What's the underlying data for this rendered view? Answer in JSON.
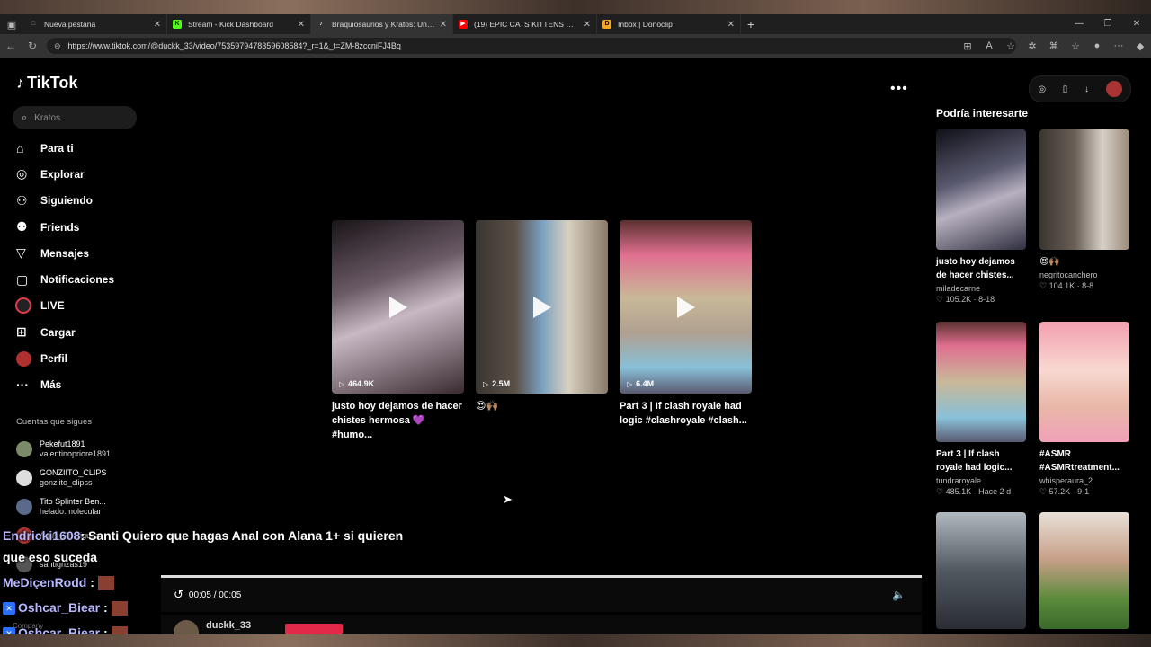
{
  "browser": {
    "tabs": [
      {
        "title": "Nueva pestaña",
        "favicon_color": "#9aa0a6",
        "favicon_glyph": "□"
      },
      {
        "title": "Stream - Kick Dashboard",
        "favicon_color": "#53fc18",
        "favicon_glyph": "K"
      },
      {
        "title": "Braquiosaurios y Kratos: Un Choq",
        "favicon_color": "#ffffff",
        "favicon_glyph": "♪",
        "active": true
      },
      {
        "title": "(19) EPIC CATS KITTENS WORLD (",
        "favicon_color": "#ff0000",
        "favicon_glyph": "▶"
      },
      {
        "title": "Inbox | Donoclip",
        "favicon_color": "#f5a623",
        "favicon_glyph": "D"
      }
    ],
    "new_tab_glyph": "+",
    "url": "https://www.tiktok.com/@duckk_33/video/7535979478359608584?_r=1&_t=ZM-8zccniFJ4Bq"
  },
  "tiktok": {
    "logo": "TikTok",
    "search_placeholder": "Kratos",
    "nav": [
      {
        "label": "Para ti",
        "icon": "home-icon",
        "glyph": "⌂"
      },
      {
        "label": "Explorar",
        "icon": "compass-icon",
        "glyph": "◎"
      },
      {
        "label": "Siguiendo",
        "icon": "following-icon",
        "glyph": "👤"
      },
      {
        "label": "Friends",
        "icon": "friends-icon",
        "glyph": "👥"
      },
      {
        "label": "Mensajes",
        "icon": "messages-icon",
        "glyph": "▽"
      },
      {
        "label": "Notificaciones",
        "icon": "bell-icon",
        "glyph": "▢"
      },
      {
        "label": "LIVE",
        "icon": "live-icon",
        "glyph": ""
      },
      {
        "label": "Cargar",
        "icon": "upload-icon",
        "glyph": "⊞"
      },
      {
        "label": "Perfil",
        "icon": "profile-icon",
        "glyph": ""
      },
      {
        "label": "Más",
        "icon": "more-icon",
        "glyph": "···"
      }
    ],
    "following_title": "Cuentas que sigues",
    "following": [
      {
        "name": "Pekefut1891",
        "handle": "valentinopriore1891",
        "color": "#7a8a6a"
      },
      {
        "name": "GONZIITO_CLIPS",
        "handle": "gonziito_clipss",
        "color": "#ddd"
      },
      {
        "name": "Tito Splinter Ben...",
        "handle": "helado.molecular",
        "color": "#5a6a8a"
      },
      {
        "name": "Agus_Rodriguez",
        "handle": "",
        "color": "#a33"
      },
      {
        "name": "",
        "handle": "santignzas19",
        "color": "#555"
      }
    ],
    "company_label": "Company",
    "videos": [
      {
        "views": "464.9K",
        "caption": "justo hoy dejamos de hacer chistes hermosa 💜 #humo...",
        "bg": "linear-gradient(160deg,#1a1418 0%,#6a5a66 35%,#c8b8c4 55%,#3a2a30 100%)"
      },
      {
        "views": "2.5M",
        "caption": "😍🙌🏽",
        "bg": "linear-gradient(90deg,#3a3530 0%,#5a5048 30%,#7aa0c0 50%,#d8d0c0 70%,#8a7a68 100%)"
      },
      {
        "views": "6.4M",
        "caption": "Part 3 | If clash royale had logic #clashroyale #clash...",
        "bg": "linear-gradient(180deg,#5a3030 0%,#e07090 20%,#c8b898 45%,#b0a090 65%,#88c0d8 85%,#5a5a70 100%)"
      }
    ],
    "recommended_title": "Podría interesarte",
    "recommended": [
      {
        "caption": "justo hoy dejamos de hacer chistes...",
        "author": "miladecarne",
        "likes": "105.2K",
        "date": "8-18",
        "bg": "linear-gradient(160deg,#101018 0%,#5a5a70 40%,#b8b0c0 60%,#303040 100%)"
      },
      {
        "caption": "😍🙌🏽",
        "author": "negritocanchero",
        "likes": "104.1K",
        "date": "8-8",
        "bg": "linear-gradient(90deg,#3a3530 0%,#6a6058 40%,#d8d0c8 70%,#9a8a78 100%)"
      },
      {
        "caption": "Part 3 | If clash royale had logic...",
        "author": "tundraroyale",
        "likes": "485.1K",
        "date": "Hace 2 d",
        "bg": "linear-gradient(180deg,#5a3030 0%,#e07090 20%,#c8b898 50%,#88c0d8 80%,#5a5a70 100%)"
      },
      {
        "caption": "#ASMR #ASMRtreatment...",
        "author": "whisperaura_2",
        "likes": "57.2K",
        "date": "9-1",
        "bg": "linear-gradient(180deg,#f2a0b0 0%,#f8d8d0 40%,#e8b8a8 70%,#f0a0b8 100%)"
      },
      {
        "caption": "",
        "author": "",
        "likes": "",
        "date": "",
        "bg": "linear-gradient(180deg,#b0b8c0 0%,#505860 50%,#2a2e34 100%)"
      },
      {
        "caption": "",
        "author": "",
        "likes": "",
        "date": "",
        "bg": "linear-gradient(180deg,#e8e0d8 0%,#c8a088 40%,#5a8a3a 75%,#3a6a2a 100%)"
      }
    ],
    "player": {
      "time": "00:05 / 00:05",
      "author": "duckk_33"
    }
  },
  "chat": [
    {
      "user": "Endricki1608",
      "message": ": Santi Quiero que hagas Anal con Alana 1+ si quieren"
    },
    {
      "user": "",
      "message": "que eso suceda"
    },
    {
      "user": "MeDiçenRodd",
      "message": ":"
    },
    {
      "user": "Oshcar_Biear",
      "message": ":"
    },
    {
      "user": "Oshcar_Biear",
      "message": ":"
    }
  ]
}
